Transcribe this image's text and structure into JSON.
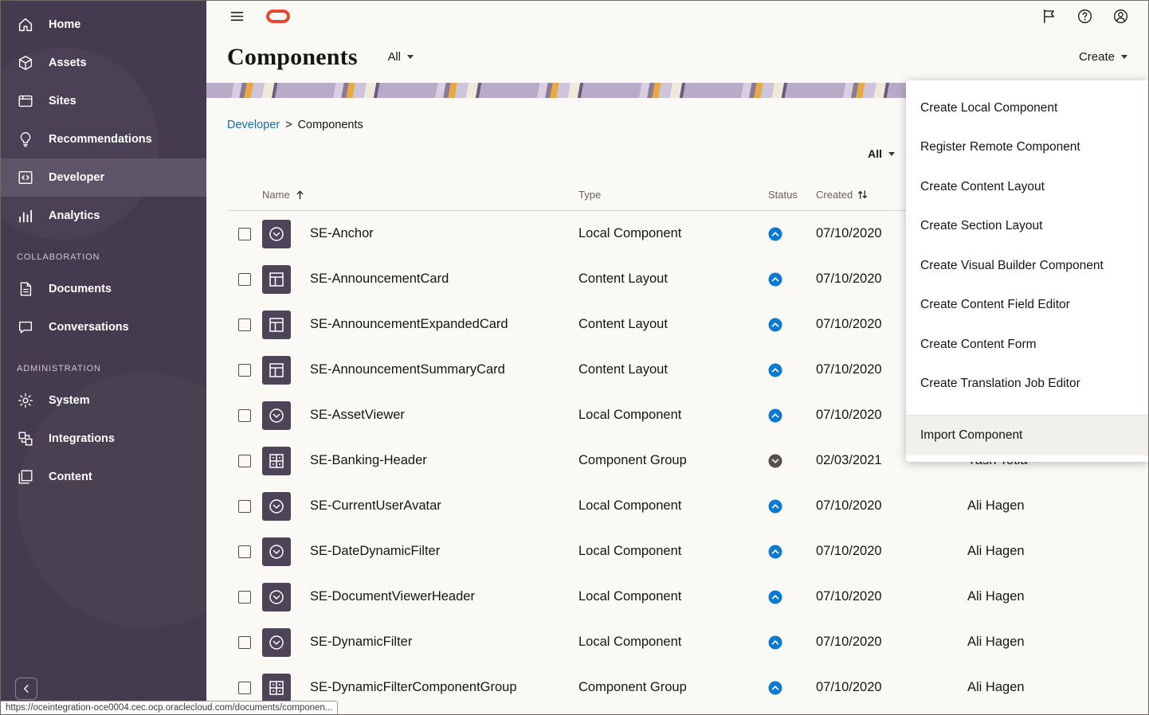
{
  "colors": {
    "sidebar_bg": "#453b4e",
    "sidebar_active_bg": "#5f5568",
    "topbar_bg": "#fbf9f6",
    "accent_red": "#e5492f",
    "link_blue": "#1c6ca8",
    "status_up_blue": "#0b79d0",
    "status_down_gray": "#55504c",
    "row_icon_purple": "#4d4458"
  },
  "topbar": {
    "left_icons": [
      "hamburger-icon",
      "oracle-logo"
    ],
    "right_icons": [
      "flag-icon",
      "help-icon",
      "account-icon"
    ]
  },
  "page_header": {
    "title": "Components",
    "scope_filter": "All",
    "create_button": "Create"
  },
  "breadcrumb": {
    "parent": "Developer",
    "separator": ">",
    "current": "Components"
  },
  "toolbar": {
    "filter": "All"
  },
  "table": {
    "headers": {
      "name": "Name",
      "type": "Type",
      "status": "Status",
      "created": "Created"
    },
    "sort": {
      "name": "asc",
      "created": "toggle"
    },
    "rows": [
      {
        "name": "SE-Anchor",
        "type": "Local Component",
        "icon": "local-component-icon",
        "status": "up",
        "created": "07/10/2020",
        "created_by": ""
      },
      {
        "name": "SE-AnnouncementCard",
        "type": "Content Layout",
        "icon": "content-layout-icon",
        "status": "up",
        "created": "07/10/2020",
        "created_by": ""
      },
      {
        "name": "SE-AnnouncementExpandedCard",
        "type": "Content Layout",
        "icon": "content-layout-icon",
        "status": "up",
        "created": "07/10/2020",
        "created_by": ""
      },
      {
        "name": "SE-AnnouncementSummaryCard",
        "type": "Content Layout",
        "icon": "content-layout-icon",
        "status": "up",
        "created": "07/10/2020",
        "created_by": ""
      },
      {
        "name": "SE-AssetViewer",
        "type": "Local Component",
        "icon": "local-component-icon",
        "status": "up",
        "created": "07/10/2020",
        "created_by": ""
      },
      {
        "name": "SE-Banking-Header",
        "type": "Component Group",
        "icon": "component-group-icon",
        "status": "down",
        "created": "02/03/2021",
        "created_by": "Yash Totla"
      },
      {
        "name": "SE-CurrentUserAvatar",
        "type": "Local Component",
        "icon": "local-component-icon",
        "status": "up",
        "created": "07/10/2020",
        "created_by": "Ali Hagen"
      },
      {
        "name": "SE-DateDynamicFilter",
        "type": "Local Component",
        "icon": "local-component-icon",
        "status": "up",
        "created": "07/10/2020",
        "created_by": "Ali Hagen"
      },
      {
        "name": "SE-DocumentViewerHeader",
        "type": "Local Component",
        "icon": "local-component-icon",
        "status": "up",
        "created": "07/10/2020",
        "created_by": "Ali Hagen"
      },
      {
        "name": "SE-DynamicFilter",
        "type": "Local Component",
        "icon": "local-component-icon",
        "status": "up",
        "created": "07/10/2020",
        "created_by": "Ali Hagen"
      },
      {
        "name": "SE-DynamicFilterComponentGroup",
        "type": "Component Group",
        "icon": "component-group-icon",
        "status": "up",
        "created": "07/10/2020",
        "created_by": "Ali Hagen"
      }
    ]
  },
  "create_menu": {
    "items": [
      "Create Local Component",
      "Register Remote Component",
      "Create Content Layout",
      "Create Section Layout",
      "Create Visual Builder Component",
      "Create Content Field Editor",
      "Create Content Form",
      "Create Translation Job Editor"
    ],
    "secondary_items": [
      "Import Component"
    ],
    "highlighted_item": "Import Component"
  },
  "sidebar": {
    "groups": [
      {
        "label": "",
        "items": [
          {
            "label": "Home",
            "icon": "home-icon",
            "active": false
          },
          {
            "label": "Assets",
            "icon": "assets-icon",
            "active": false
          },
          {
            "label": "Sites",
            "icon": "sites-icon",
            "active": false
          },
          {
            "label": "Recommendations",
            "icon": "recommendations-icon",
            "active": false
          },
          {
            "label": "Developer",
            "icon": "developer-icon",
            "active": true
          },
          {
            "label": "Analytics",
            "icon": "analytics-icon",
            "active": false
          }
        ]
      },
      {
        "label": "COLLABORATION",
        "items": [
          {
            "label": "Documents",
            "icon": "documents-icon",
            "active": false
          },
          {
            "label": "Conversations",
            "icon": "conversations-icon",
            "active": false
          }
        ]
      },
      {
        "label": "ADMINISTRATION",
        "items": [
          {
            "label": "System",
            "icon": "system-icon",
            "active": false
          },
          {
            "label": "Integrations",
            "icon": "integrations-icon",
            "active": false
          },
          {
            "label": "Content",
            "icon": "content-icon",
            "active": false
          }
        ]
      }
    ],
    "collapse_icon": "chevron-left-icon"
  },
  "status_url": "https://oceintegration-oce0004.cec.ocp.oraclecloud.com/documents/componen..."
}
